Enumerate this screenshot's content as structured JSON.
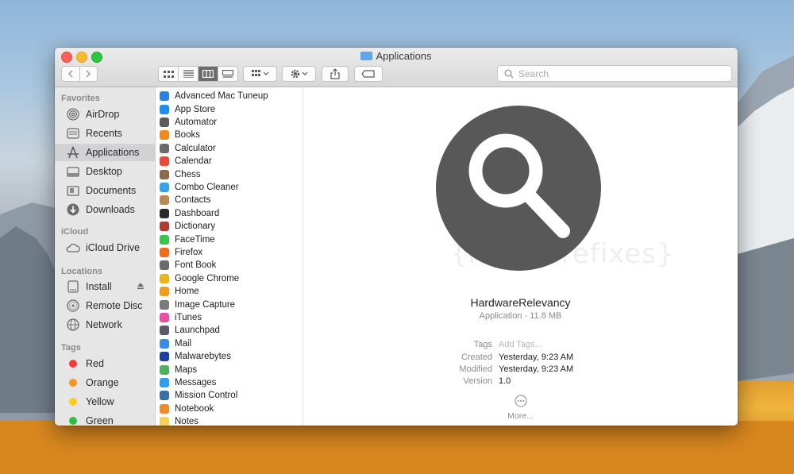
{
  "window": {
    "title": "Applications"
  },
  "toolbar": {
    "search_placeholder": "Search",
    "view_modes": [
      "icon-view",
      "list-view",
      "column-view",
      "gallery-view"
    ],
    "active_view": "column-view"
  },
  "sidebar": {
    "favorites_header": "Favorites",
    "favorites": [
      {
        "label": "AirDrop",
        "icon": "airdrop-icon"
      },
      {
        "label": "Recents",
        "icon": "recents-icon"
      },
      {
        "label": "Applications",
        "icon": "applications-icon",
        "selected": true
      },
      {
        "label": "Desktop",
        "icon": "desktop-icon"
      },
      {
        "label": "Documents",
        "icon": "documents-icon"
      },
      {
        "label": "Downloads",
        "icon": "downloads-icon"
      }
    ],
    "icloud_header": "iCloud",
    "icloud": [
      {
        "label": "iCloud Drive",
        "icon": "cloud-icon"
      }
    ],
    "locations_header": "Locations",
    "locations": [
      {
        "label": "Install",
        "icon": "disk-icon"
      },
      {
        "label": "Remote Disc",
        "icon": "disc-icon"
      },
      {
        "label": "Network",
        "icon": "network-icon"
      }
    ],
    "tags_header": "Tags",
    "tags": [
      {
        "label": "Red",
        "color": "#ee3b34"
      },
      {
        "label": "Orange",
        "color": "#f7961f"
      },
      {
        "label": "Yellow",
        "color": "#fbcc1d"
      },
      {
        "label": "Green",
        "color": "#2fbf3e"
      }
    ]
  },
  "applications": [
    {
      "name": "Advanced Mac Tuneup",
      "color": "#2f7fe0"
    },
    {
      "name": "App Store",
      "color": "#1a8ff0"
    },
    {
      "name": "Automator",
      "color": "#5b5b5b"
    },
    {
      "name": "Books",
      "color": "#f08a1e"
    },
    {
      "name": "Calculator",
      "color": "#6a6a6a"
    },
    {
      "name": "Calendar",
      "color": "#e84b3a"
    },
    {
      "name": "Chess",
      "color": "#8a6a4a"
    },
    {
      "name": "Combo Cleaner",
      "color": "#38a3e8"
    },
    {
      "name": "Contacts",
      "color": "#b98a55"
    },
    {
      "name": "Dashboard",
      "color": "#2b2b2b"
    },
    {
      "name": "Dictionary",
      "color": "#b33a2e"
    },
    {
      "name": "FaceTime",
      "color": "#3cc24e"
    },
    {
      "name": "Firefox",
      "color": "#f26b1d"
    },
    {
      "name": "Font Book",
      "color": "#6a6a6a"
    },
    {
      "name": "Google Chrome",
      "color": "#e8b51f"
    },
    {
      "name": "Home",
      "color": "#f29b21"
    },
    {
      "name": "Image Capture",
      "color": "#7a7a7a"
    },
    {
      "name": "iTunes",
      "color": "#e64fa3"
    },
    {
      "name": "Launchpad",
      "color": "#5a5a6a"
    },
    {
      "name": "Mail",
      "color": "#3a8be8"
    },
    {
      "name": "Malwarebytes",
      "color": "#1e3fa6"
    },
    {
      "name": "Maps",
      "color": "#4bb25b"
    },
    {
      "name": "Messages",
      "color": "#2f9cf0"
    },
    {
      "name": "Mission Control",
      "color": "#3a6fa8"
    },
    {
      "name": "Notebook",
      "color": "#f08a2a"
    },
    {
      "name": "Notes",
      "color": "#f5d253"
    }
  ],
  "preview": {
    "icon": "magnifier-icon",
    "name": "HardwareRelevancy",
    "kind": "Application - 11.8 MB",
    "tags_label": "Tags",
    "tags_placeholder": "Add Tags...",
    "created_label": "Created",
    "created_value": "Yesterday, 9:23 AM",
    "modified_label": "Modified",
    "modified_value": "Yesterday, 9:23 AM",
    "version_label": "Version",
    "version_value": "1.0",
    "more_label": "More..."
  },
  "watermark": "{malwarefixes}"
}
